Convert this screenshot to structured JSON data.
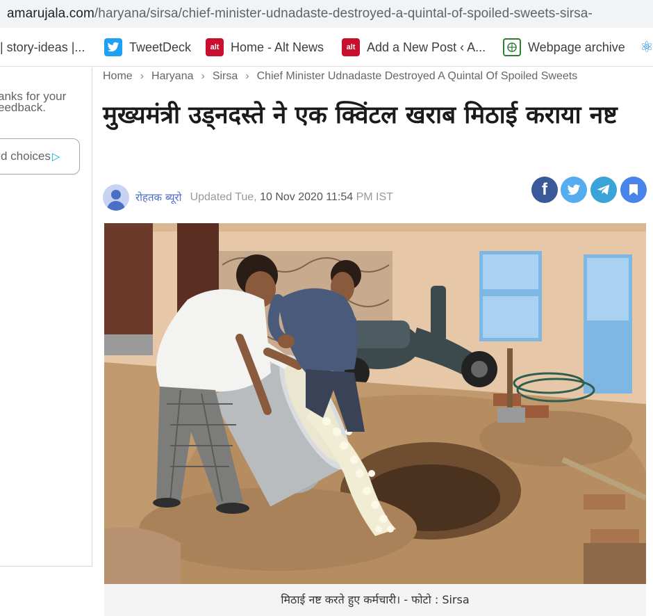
{
  "browser": {
    "url_domain": "amarujala.com",
    "url_path": "/haryana/sirsa/chief-minister-udnadaste-destroyed-a-quintal-of-spoiled-sweets-sirsa-"
  },
  "bookmarks": [
    {
      "label": "| story-ideas |...",
      "icon": "none"
    },
    {
      "label": "TweetDeck",
      "icon": "tweetdeck-icon"
    },
    {
      "label": "Home - Alt News",
      "icon": "altnews-icon"
    },
    {
      "label": "Add a New Post ‹ A...",
      "icon": "altnews-icon"
    },
    {
      "label": "Webpage archive",
      "icon": "archive-icon"
    },
    {
      "label": "",
      "icon": "react-icon"
    }
  ],
  "sidebar": {
    "thanks_line1": "anks for your",
    "thanks_line2": "eedback.",
    "choices_label": "d choices",
    "choices_icon": "▷"
  },
  "breadcrumb": {
    "home": "Home",
    "state": "Haryana",
    "city": "Sirsa",
    "current": "Chief Minister Udnadaste Destroyed A Quintal Of Spoiled Sweets",
    "separator": "›"
  },
  "article": {
    "title": "मुख्यमंत्री उड्नदस्ते ने एक क्विंटल खराब मिठाई कराया नष्ट",
    "author": "रोहतक ब्यूरो",
    "updated_prefix": "Updated Tue,",
    "updated_date": "10 Nov 2020 11:54",
    "updated_suffix": "PM IST",
    "caption": "मिठाई नष्ट करते हुए कर्मचारी। - फोटो : Sirsa"
  },
  "share": {
    "facebook_glyph": "f"
  },
  "colors": {
    "facebook": "#3b5998",
    "twitter": "#55acee",
    "telegram": "#3aa3d8",
    "bookmark": "#4a84e8",
    "author_link": "#4a6fc5"
  }
}
